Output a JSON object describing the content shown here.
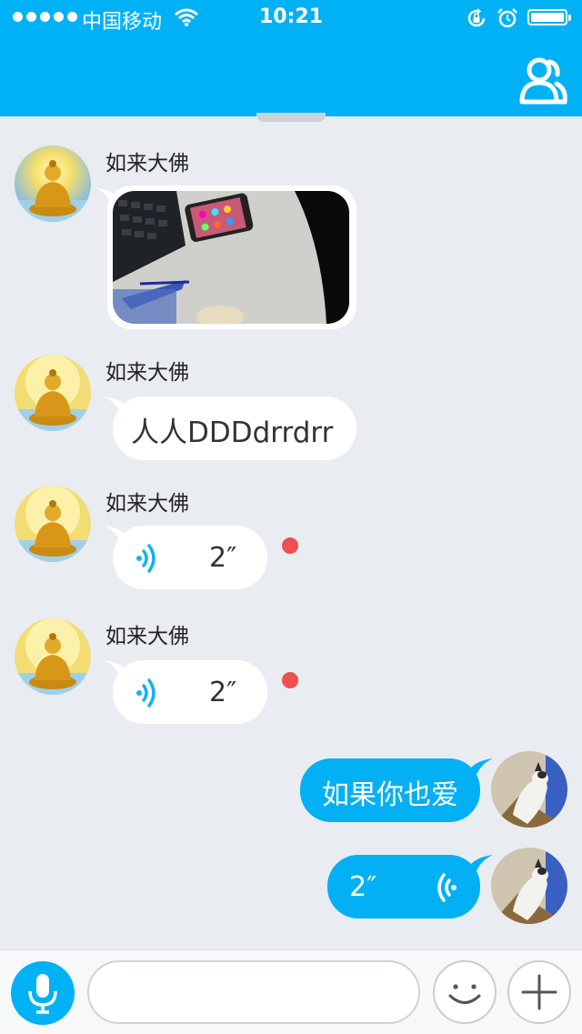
{
  "status": {
    "carrier": "中国移动",
    "time": "10:21"
  },
  "colors": {
    "accent": "#00b2f5",
    "incoming_bubble": "#ffffff",
    "outgoing_bubble": "#03b0f3",
    "unread_dot": "#ee5050",
    "background": "#e9ecf1"
  },
  "header": {
    "contacts_icon": "contacts-icon"
  },
  "messages": [
    {
      "type": "image",
      "sender": "如来大佛",
      "direction": "incoming"
    },
    {
      "type": "text",
      "sender": "如来大佛",
      "direction": "incoming",
      "text": "人人DDDdrrdrr"
    },
    {
      "type": "voice",
      "sender": "如来大佛",
      "direction": "incoming",
      "duration": "2″",
      "unread": true
    },
    {
      "type": "voice",
      "sender": "如来大佛",
      "direction": "incoming",
      "duration": "2″",
      "unread": true
    },
    {
      "type": "text",
      "direction": "outgoing",
      "text": "如果你也爱"
    },
    {
      "type": "voice",
      "direction": "outgoing",
      "duration": "2″"
    }
  ],
  "composer": {
    "input_value": "",
    "placeholder": "",
    "icons": [
      "microphone-icon",
      "emoji-icon",
      "plus-icon"
    ]
  }
}
